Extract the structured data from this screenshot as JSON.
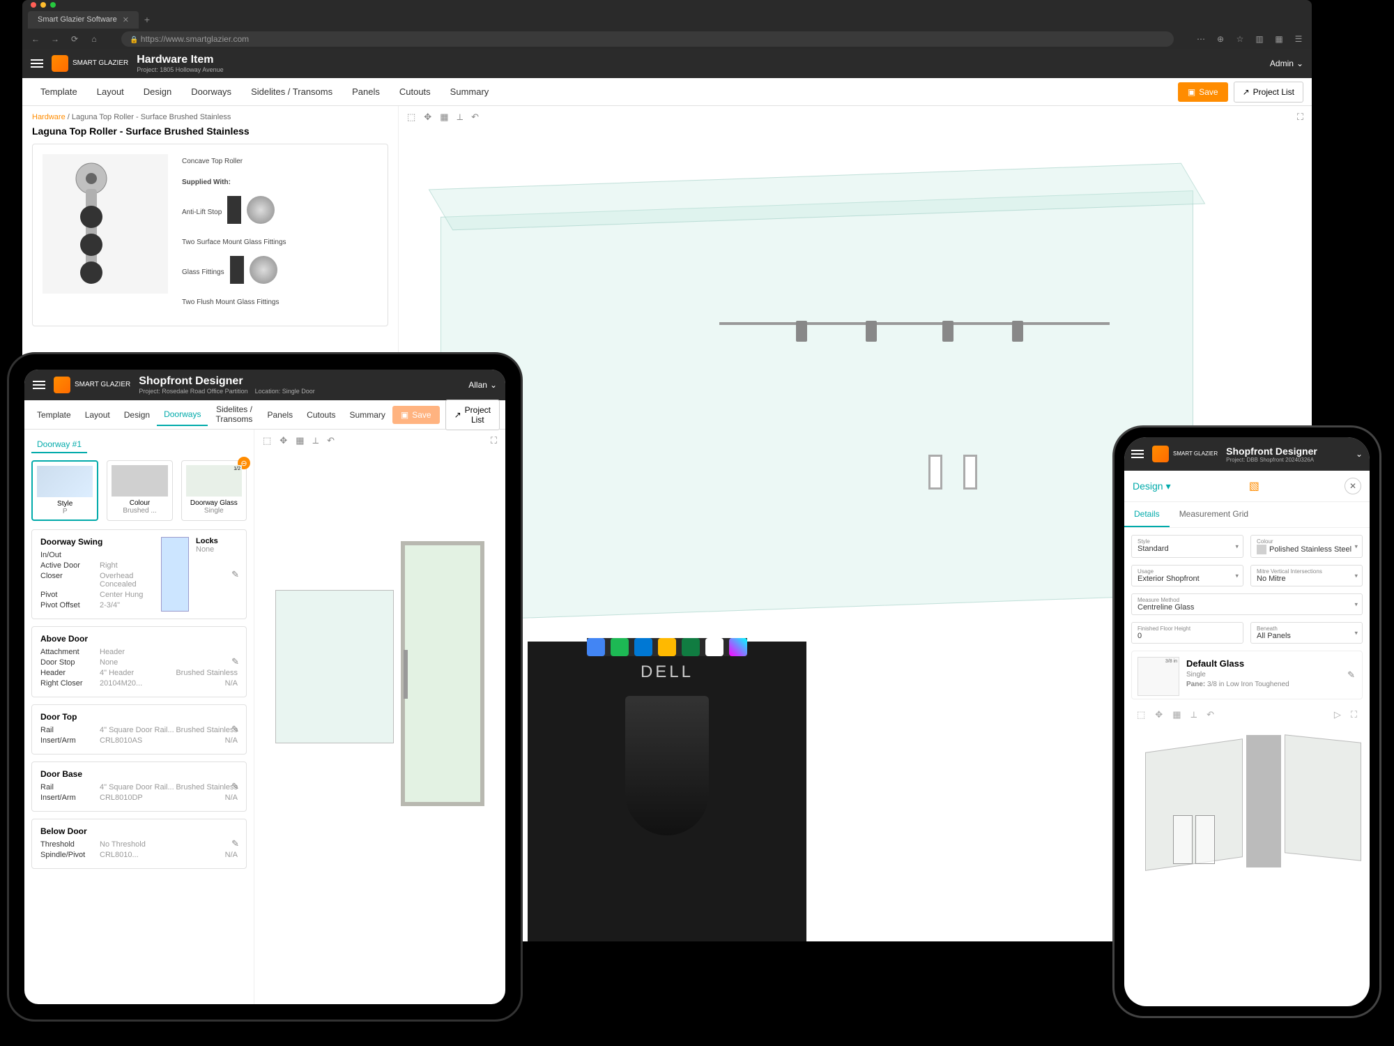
{
  "browser": {
    "tab_title": "Smart Glazier Software",
    "url": "https://www.smartglazier.com"
  },
  "desktop_app": {
    "title": "Hardware Item",
    "project_label": "Project:",
    "project_value": "1805 Holloway Avenue",
    "user": "Admin",
    "tabs": [
      "Template",
      "Layout",
      "Design",
      "Doorways",
      "Sidelites / Transoms",
      "Panels",
      "Cutouts",
      "Summary"
    ],
    "save": "Save",
    "project_list": "Project List",
    "breadcrumb_root": "Hardware",
    "breadcrumb_rest": " / Laguna Top Roller - Surface Brushed Stainless",
    "hardware_name": "Laguna Top Roller - Surface Brushed Stainless",
    "hw_labels": {
      "concave": "Concave Top Roller",
      "supplied": "Supplied With:",
      "antilift": "Anti-Lift Stop",
      "surface": "Two Surface Mount Glass Fittings",
      "glass": "Glass Fittings",
      "flush": "Two Flush Mount Glass Fittings"
    }
  },
  "tablet_app": {
    "title": "Shopfront Designer",
    "project_label": "Project:",
    "project_value": "Rosedale Road Office Partition",
    "location_label": "Location:",
    "location_value": "Single Door",
    "user": "Allan",
    "tabs": [
      "Template",
      "Layout",
      "Design",
      "Doorways",
      "Sidelites / Transoms",
      "Panels",
      "Cutouts",
      "Summary"
    ],
    "active_tab_index": 3,
    "save": "Save",
    "project_list": "Project List",
    "doorway_label": "Doorway #1",
    "options": {
      "style_title": "Style",
      "style_val": "P",
      "colour_title": "Colour",
      "colour_val": "Brushed ...",
      "glass_title": "Doorway Glass",
      "glass_val": "Single"
    },
    "swing": {
      "title": "Doorway Swing",
      "rows": [
        {
          "k": "In/Out",
          "v": ""
        },
        {
          "k": "Active Door",
          "v": "Right"
        },
        {
          "k": "Closer",
          "v": "Overhead Concealed"
        },
        {
          "k": "Pivot",
          "v": "Center Hung"
        },
        {
          "k": "Pivot Offset",
          "v": "2-3/4\""
        }
      ],
      "locks_title": "Locks",
      "locks_val": "None"
    },
    "above_door": {
      "title": "Above Door",
      "rows": [
        {
          "k": "Attachment",
          "v": "Header"
        },
        {
          "k": "Door Stop",
          "v": "None"
        },
        {
          "k": "Header",
          "v": "4\" Header",
          "v2": "Brushed Stainless"
        },
        {
          "k": "Right Closer",
          "v": "20104M20...",
          "v2": "N/A"
        }
      ]
    },
    "door_top": {
      "title": "Door Top",
      "rows": [
        {
          "k": "Rail",
          "v": "4\" Square Door Rail...",
          "v2": "Brushed Stainless"
        },
        {
          "k": "Insert/Arm",
          "v": "CRL8010AS",
          "v2": "N/A"
        }
      ]
    },
    "door_base": {
      "title": "Door Base",
      "rows": [
        {
          "k": "Rail",
          "v": "4\" Square Door Rail...",
          "v2": "Brushed Stainless"
        },
        {
          "k": "Insert/Arm",
          "v": "CRL8010DP",
          "v2": "N/A"
        }
      ]
    },
    "below_door": {
      "title": "Below Door",
      "rows": [
        {
          "k": "Threshold",
          "v": "No Threshold"
        },
        {
          "k": "Spindle/Pivot",
          "v": "CRL8010...",
          "v2": "N/A"
        }
      ]
    }
  },
  "phone_app": {
    "title": "Shopfront Designer",
    "project_label": "Project:",
    "project_value": "DBB Shopfront 20240326A",
    "design_label": "Design",
    "tabs": [
      "Details",
      "Measurement Grid"
    ],
    "fields": {
      "style": {
        "label": "Style",
        "value": "Standard"
      },
      "colour": {
        "label": "Colour",
        "value": "Polished Stainless Steel"
      },
      "usage": {
        "label": "Usage",
        "value": "Exterior Shopfront"
      },
      "mitre": {
        "label": "Mitre Vertical Intersections",
        "value": "No Mitre"
      },
      "measure": {
        "label": "Measure Method",
        "value": "Centreline Glass"
      },
      "floor": {
        "label": "Finished Floor Height",
        "value": "0"
      },
      "beneath": {
        "label": "Beneath",
        "value": "All Panels"
      }
    },
    "glass": {
      "thickness": "3/8 in",
      "title": "Default Glass",
      "type": "Single",
      "pane_label": "Pane:",
      "pane_value": "3/8 in Low Iron Toughened"
    }
  },
  "logo_brand": "SMART GLAZIER",
  "dell": "DELL"
}
